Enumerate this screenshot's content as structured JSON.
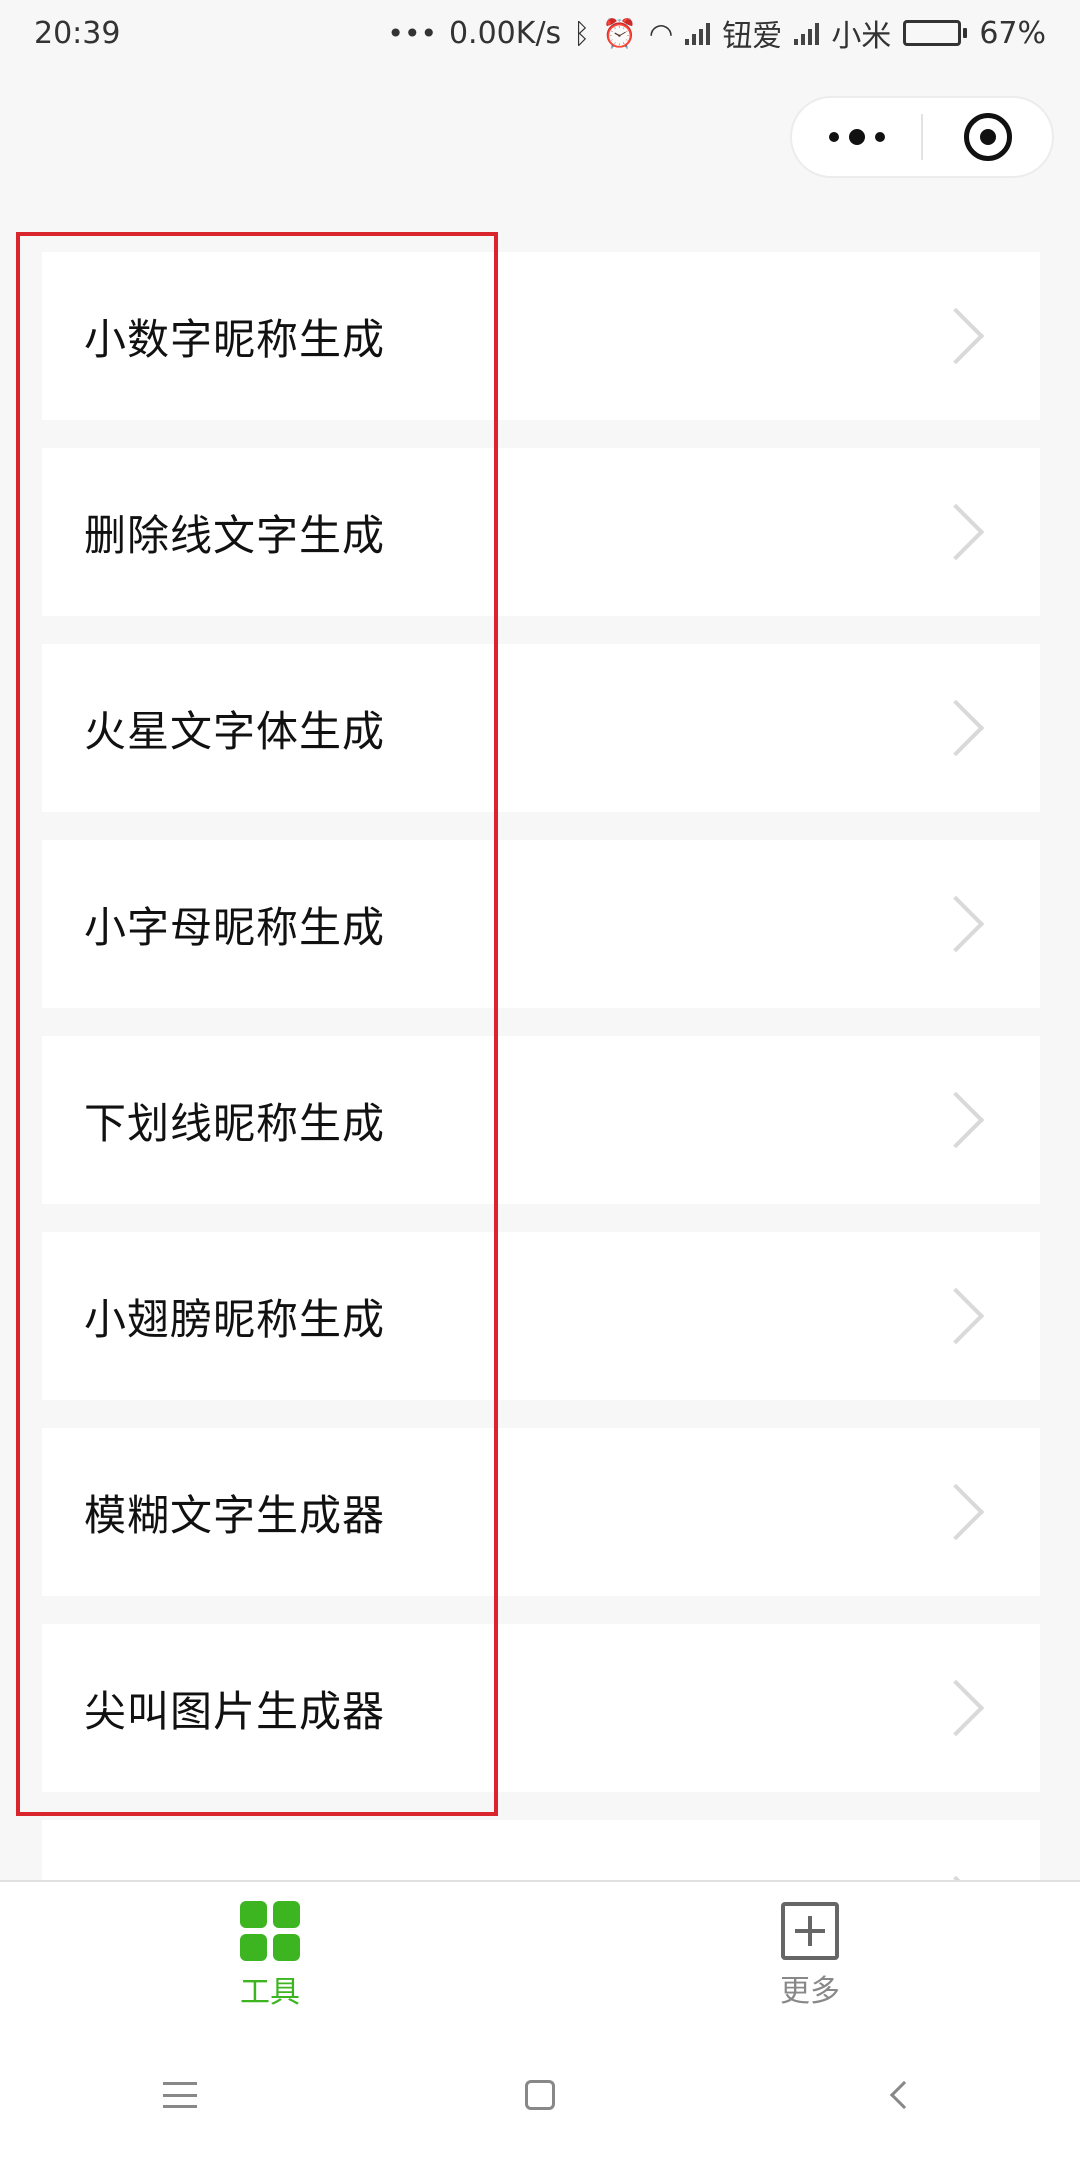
{
  "status_bar": {
    "time": "20:39",
    "network_speed": "0.00K/s",
    "carrier_1": "钮爱",
    "carrier_2": "小米",
    "battery_percent": "67%",
    "battery_level": 0.67,
    "icons": [
      "more-dots-icon",
      "bluetooth-icon",
      "alarm-icon",
      "wifi-icon",
      "signal-icon",
      "battery-icon"
    ]
  },
  "capsule": {
    "icons": [
      "more-icon",
      "close-target-icon"
    ]
  },
  "list": {
    "items": [
      {
        "label": "小数字昵称生成"
      },
      {
        "label": "删除线文字生成"
      },
      {
        "label": "火星文字体生成"
      },
      {
        "label": "小字母昵称生成"
      },
      {
        "label": "下划线昵称生成"
      },
      {
        "label": "小翅膀昵称生成"
      },
      {
        "label": "模糊文字生成器"
      },
      {
        "label": "尖叫图片生成器"
      }
    ]
  },
  "tab_bar": {
    "tabs": [
      {
        "label": "工具",
        "active": true,
        "icon": "grid-icon"
      },
      {
        "label": "更多",
        "active": false,
        "icon": "plus-square-icon"
      }
    ]
  },
  "colors": {
    "accent": "#3cb521",
    "highlight": "#d9262c",
    "chevron": "#d9d9d9",
    "background": "#f7f7f7"
  }
}
